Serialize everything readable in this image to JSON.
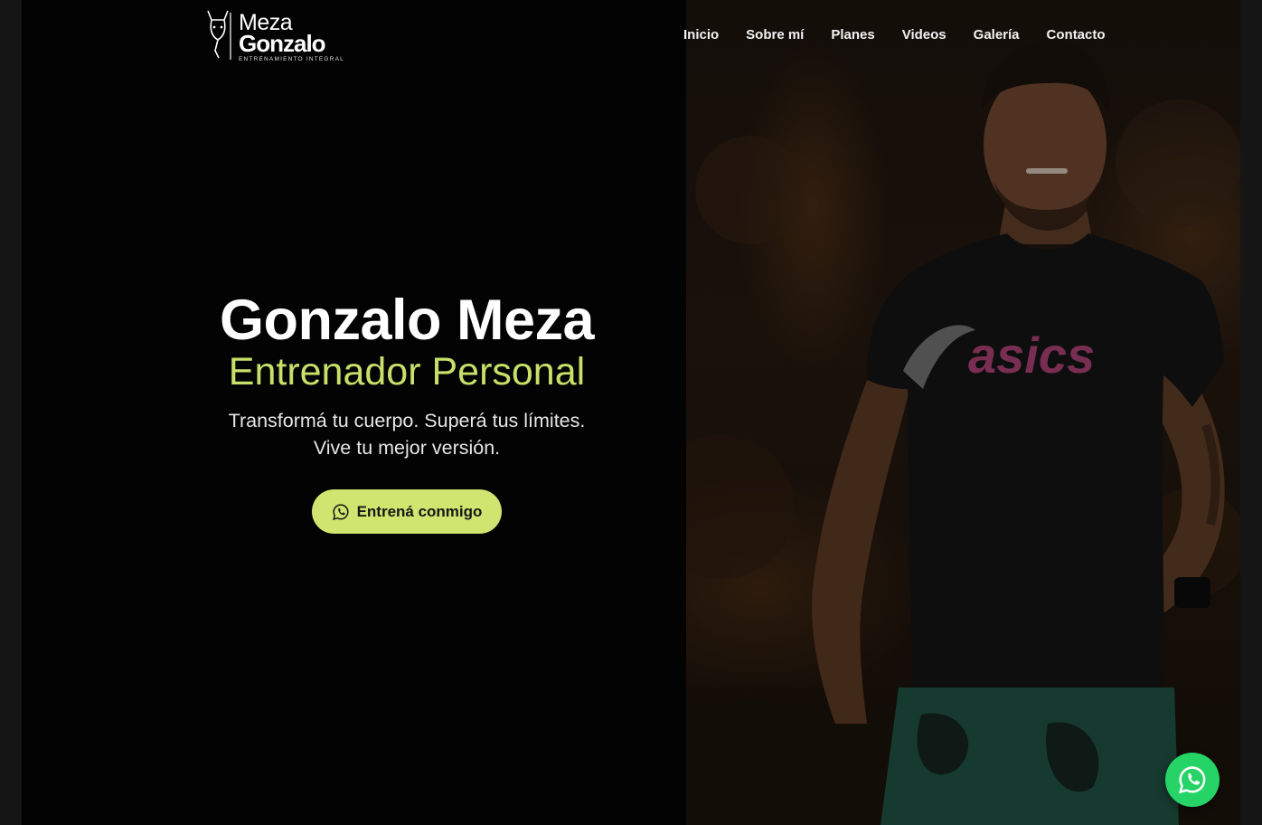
{
  "brand": {
    "line1": "Meza",
    "line2": "Gonzalo",
    "tagline": "ENTRENAMIENTO INTEGRAL",
    "mark_icon": "deer-head-logo-icon"
  },
  "nav": {
    "items": [
      {
        "label": "Inicio"
      },
      {
        "label": "Sobre mí"
      },
      {
        "label": "Planes"
      },
      {
        "label": "Videos"
      },
      {
        "label": "Galería"
      },
      {
        "label": "Contacto"
      }
    ]
  },
  "hero": {
    "title": "Gonzalo Meza",
    "subtitle": "Entrenador Personal",
    "line1": "Transformá tu cuerpo. Superá tus límites.",
    "line2": "Vive tu mejor versión.",
    "cta_label": "Entrená conmigo",
    "cta_icon": "whatsapp-icon",
    "photo_shirt_text": "asics"
  },
  "floating": {
    "icon": "whatsapp-icon"
  },
  "colors": {
    "accent": "#cfe56f",
    "accent_text": "#c7e06a",
    "background": "#030303",
    "whatsapp": "#25d366"
  }
}
